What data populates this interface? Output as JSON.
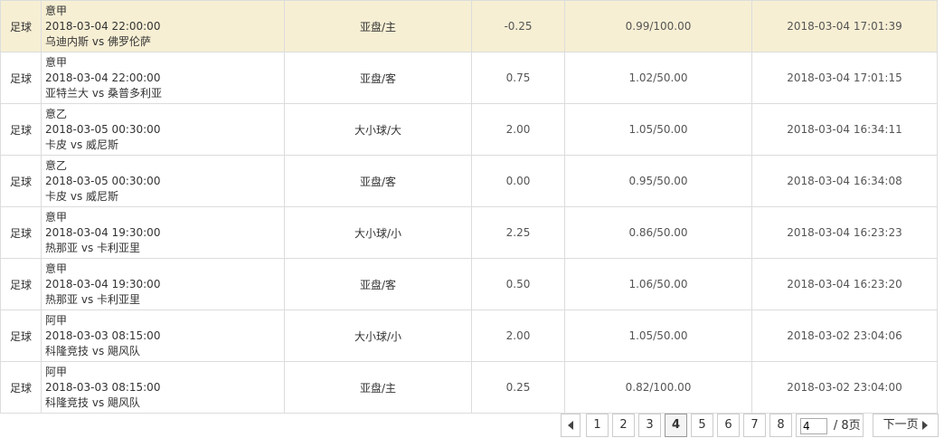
{
  "rows": [
    {
      "sport": "足球",
      "league": "意甲",
      "match_time": "2018-03-04 22:00:00",
      "home": "乌迪内斯",
      "vs": "vs",
      "away": "佛罗伦萨",
      "bet_type": "亚盘/主",
      "line": "-0.25",
      "odds_stake": "0.99/100.00",
      "placed_at": "2018-03-04 17:01:39",
      "highlighted": true
    },
    {
      "sport": "足球",
      "league": "意甲",
      "match_time": "2018-03-04 22:00:00",
      "home": "亚特兰大",
      "vs": "vs",
      "away": "桑普多利亚",
      "bet_type": "亚盘/客",
      "line": "0.75",
      "odds_stake": "1.02/50.00",
      "placed_at": "2018-03-04 17:01:15",
      "highlighted": false
    },
    {
      "sport": "足球",
      "league": "意乙",
      "match_time": "2018-03-05 00:30:00",
      "home": "卡皮",
      "vs": "vs",
      "away": "威尼斯",
      "bet_type": "大小球/大",
      "line": "2.00",
      "odds_stake": "1.05/50.00",
      "placed_at": "2018-03-04 16:34:11",
      "highlighted": false
    },
    {
      "sport": "足球",
      "league": "意乙",
      "match_time": "2018-03-05 00:30:00",
      "home": "卡皮",
      "vs": "vs",
      "away": "威尼斯",
      "bet_type": "亚盘/客",
      "line": "0.00",
      "odds_stake": "0.95/50.00",
      "placed_at": "2018-03-04 16:34:08",
      "highlighted": false
    },
    {
      "sport": "足球",
      "league": "意甲",
      "match_time": "2018-03-04 19:30:00",
      "home": "热那亚",
      "vs": "vs",
      "away": "卡利亚里",
      "bet_type": "大小球/小",
      "line": "2.25",
      "odds_stake": "0.86/50.00",
      "placed_at": "2018-03-04 16:23:23",
      "highlighted": false
    },
    {
      "sport": "足球",
      "league": "意甲",
      "match_time": "2018-03-04 19:30:00",
      "home": "热那亚",
      "vs": "vs",
      "away": "卡利亚里",
      "bet_type": "亚盘/客",
      "line": "0.50",
      "odds_stake": "1.06/50.00",
      "placed_at": "2018-03-04 16:23:20",
      "highlighted": false
    },
    {
      "sport": "足球",
      "league": "阿甲",
      "match_time": "2018-03-03 08:15:00",
      "home": "科隆竞技",
      "vs": "vs",
      "away": "飓风队",
      "bet_type": "大小球/小",
      "line": "2.00",
      "odds_stake": "1.05/50.00",
      "placed_at": "2018-03-02 23:04:06",
      "highlighted": false
    },
    {
      "sport": "足球",
      "league": "阿甲",
      "match_time": "2018-03-03 08:15:00",
      "home": "科隆竞技",
      "vs": "vs",
      "away": "飓风队",
      "bet_type": "亚盘/主",
      "line": "0.25",
      "odds_stake": "0.82/100.00",
      "placed_at": "2018-03-02 23:04:00",
      "highlighted": false
    }
  ],
  "pagination": {
    "pages": [
      "1",
      "2",
      "3",
      "4",
      "5",
      "6",
      "7",
      "8"
    ],
    "current": "4",
    "input_value": "4",
    "total_text": "/ 8页",
    "next_label": "下一页",
    "prev_icon": "triangle-left-icon",
    "next_icon": "triangle-right-icon"
  },
  "colors": {
    "highlight_row": "#f7efd4",
    "border": "#dcdcdc"
  }
}
